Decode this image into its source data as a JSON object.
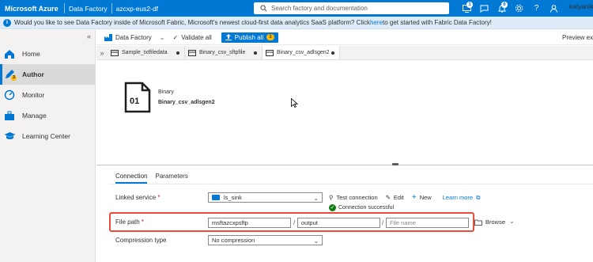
{
  "topbar": {
    "brand": "Microsoft Azure",
    "service": "Data Factory",
    "factory": "azcxp-eus2-df",
    "search_placeholder": "Search factory and documentation",
    "notifications": [
      {
        "icon": "monitor-icon",
        "count": "1"
      },
      {
        "icon": "chat-icon",
        "count": ""
      },
      {
        "icon": "bell-icon",
        "count": "6"
      },
      {
        "icon": "gear-icon",
        "count": ""
      },
      {
        "icon": "help-icon",
        "count": ""
      },
      {
        "icon": "feedback-icon",
        "count": ""
      }
    ],
    "user": "kalyanik"
  },
  "banner": {
    "text_before": "Would you like to see Data Factory inside of Microsoft Fabric, Microsoft's newest cloud-first data analytics SaaS platform? Click ",
    "link": "here",
    "text_after": " to get started with Fabric Data Factory!"
  },
  "sidebar": {
    "items": [
      {
        "label": "Home",
        "icon": "home-icon",
        "active": false
      },
      {
        "label": "Author",
        "icon": "pencil-icon",
        "active": true,
        "badge": "3"
      },
      {
        "label": "Monitor",
        "icon": "monitor-gauge-icon",
        "active": false
      },
      {
        "label": "Manage",
        "icon": "toolbox-icon",
        "active": false
      },
      {
        "label": "Learning Center",
        "icon": "graduation-cap-icon",
        "active": false
      }
    ]
  },
  "toolbar": {
    "data_factory": "Data Factory",
    "validate_all": "Validate all",
    "publish_all": "Publish all",
    "publish_count": "3",
    "preview": "Preview exp"
  },
  "tabs": [
    {
      "label": "Sample_txtfiledata",
      "active": false
    },
    {
      "label": "Binary_csv_sftpfile",
      "active": false
    },
    {
      "label": "Binary_csv_adlsgen2",
      "active": true
    }
  ],
  "dataset": {
    "type": "Binary",
    "name": "Binary_csv_adlsgen2",
    "icon_text": "01"
  },
  "properties": {
    "tabs": [
      "Connection",
      "Parameters"
    ],
    "linked_service_label": "Linked service",
    "linked_service_value": "ls_sink",
    "test_connection": "Test connection",
    "edit": "Edit",
    "new": "New",
    "learn_more": "Learn more",
    "connection_status": "Connection successful",
    "file_path_label": "File path",
    "path_container": "msftazcxpsftp",
    "path_directory": "output",
    "path_file_placeholder": "File name",
    "browse": "Browse",
    "compression_label": "Compression type",
    "compression_value": "No compression"
  },
  "colors": {
    "accent": "#0078d4",
    "highlight": "#e74c3c",
    "success": "#107c10"
  }
}
